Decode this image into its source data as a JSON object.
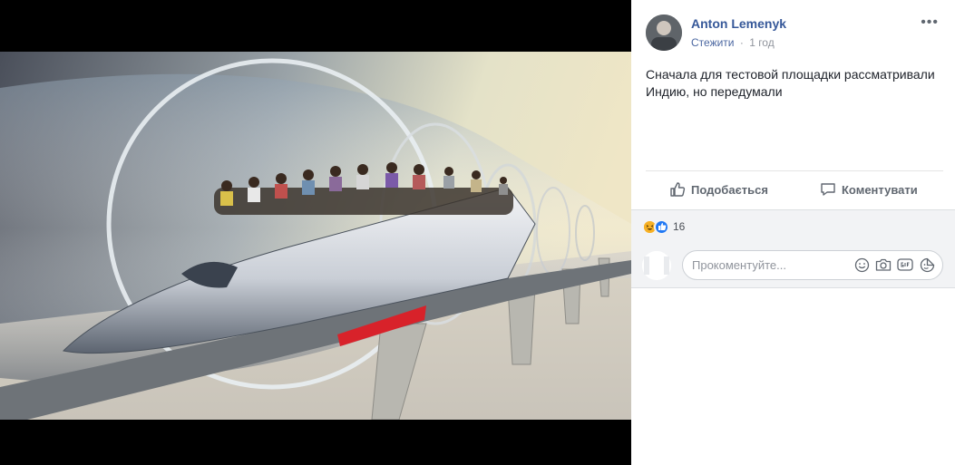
{
  "post": {
    "author": "Anton Lemenyk",
    "follow_label": "Стежити",
    "separator": "·",
    "time": "1 год",
    "more_label": "•••",
    "text": "Сначала для тестовой площадки рассматривали Индию, но передумали"
  },
  "actions": {
    "like_label": "Подобається",
    "comment_label": "Коментувати"
  },
  "reactions": {
    "count": "16",
    "types": [
      "haha",
      "like"
    ]
  },
  "comment": {
    "placeholder": "Прокоментуйте..."
  },
  "icons": {
    "more": "more-icon",
    "like": "thumbs-up-icon",
    "comment": "speech-bubble-icon",
    "emoji": "smiley-icon",
    "camera": "camera-icon",
    "gif": "gif-icon",
    "sticker": "sticker-icon"
  },
  "colors": {
    "author_link": "#365899",
    "follow_link": "#4b67a1",
    "like_blue": "#2078f4",
    "haha_yellow": "#f7b125"
  }
}
